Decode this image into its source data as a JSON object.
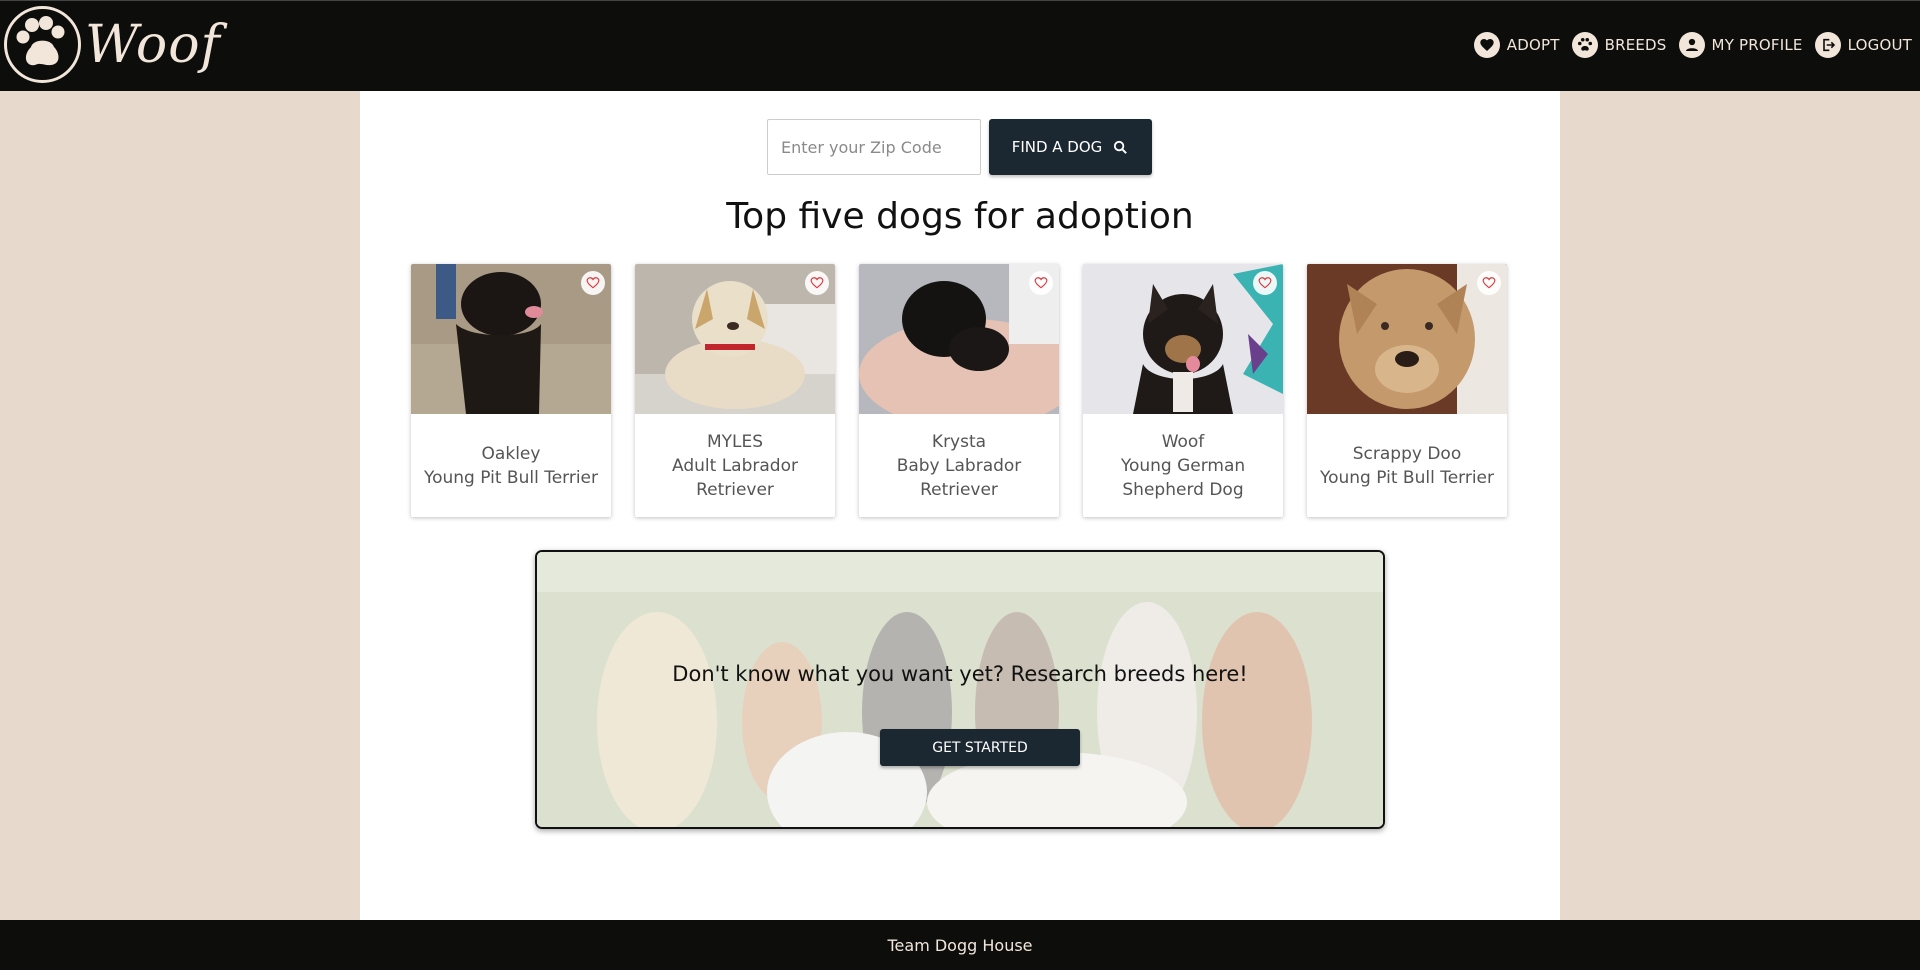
{
  "header": {
    "logo_text": "Woof",
    "nav": [
      {
        "label": "ADOPT",
        "icon": "heart-icon"
      },
      {
        "label": "BREEDS",
        "icon": "paw-icon"
      },
      {
        "label": "MY PROFILE",
        "icon": "user-icon"
      },
      {
        "label": "LOGOUT",
        "icon": "logout-icon"
      }
    ]
  },
  "search": {
    "placeholder": "Enter your Zip Code",
    "value": "",
    "button_label": "FIND A DOG",
    "button_icon": "search-icon"
  },
  "headline": "Top five dogs for adoption",
  "dogs": [
    {
      "name": "Oakley",
      "description": "Young Pit Bull Terrier"
    },
    {
      "name": "MYLES",
      "description": "Adult Labrador Retriever"
    },
    {
      "name": "Krysta",
      "description": "Baby Labrador Retriever"
    },
    {
      "name": "Woof",
      "description": "Young German Shepherd Dog"
    },
    {
      "name": "Scrappy Doo",
      "description": "Young Pit Bull Terrier"
    }
  ],
  "banner": {
    "title": "Don't know what you want yet? Research breeds here!",
    "button_label": "GET STARTED"
  },
  "footer": {
    "text": "Team Dogg House"
  },
  "colors": {
    "header_bg": "#0d0d0c",
    "page_bg": "#e7dacd",
    "button_bg": "#1c2831",
    "heart": "#e0383e"
  }
}
